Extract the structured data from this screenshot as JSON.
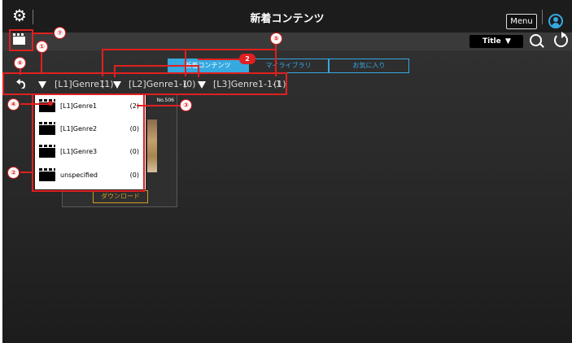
{
  "header": {
    "title": "新着コンテンツ",
    "menu_label": "Menu"
  },
  "subbar": {
    "sort_label": "Title",
    "sort_arrow": "▼"
  },
  "tabs": [
    {
      "label": "新着コンテンツ",
      "active": true
    },
    {
      "label": "マイライブラリ",
      "active": false
    },
    {
      "label": "お気に入り",
      "active": false
    }
  ],
  "breadcrumb": {
    "items": [
      {
        "label": "[L1]Genre1",
        "count": "(1)"
      },
      {
        "label": "[L2]Genre1-1",
        "count": "(0)"
      },
      {
        "label": "[L3]Genre1-1-1",
        "count": "(1)"
      }
    ]
  },
  "card": {
    "number": "No.506",
    "download_label": "ダウンロード"
  },
  "dropdown": {
    "items": [
      {
        "label": "[L1]Genre1",
        "count": "(2)"
      },
      {
        "label": "[L1]Genre2",
        "count": "(0)"
      },
      {
        "label": "[L1]Genre3",
        "count": "(0)"
      },
      {
        "label": "unspecified",
        "count": "(0)"
      }
    ]
  },
  "annotations": {
    "n1": "①",
    "n2": "②",
    "n3": "③",
    "n4": "④",
    "n5": "⑤",
    "n6": "⑥",
    "n7": "⑦",
    "badge2": "2"
  },
  "colors": {
    "accent": "#36a9e1",
    "annotation": "#e02020",
    "download": "#d59b2a"
  }
}
